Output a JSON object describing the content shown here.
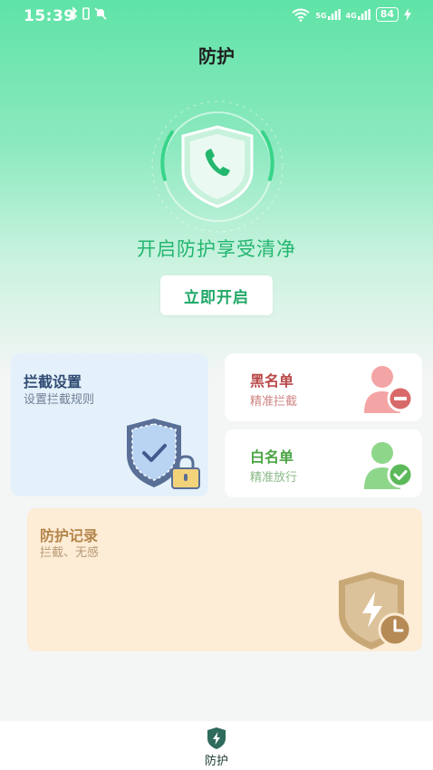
{
  "status_bar": {
    "time": "15:39",
    "battery": "84",
    "network_labels": [
      "5G",
      "4G"
    ]
  },
  "header": {
    "title": "防护"
  },
  "hero": {
    "slogan": "开启防护享受清净",
    "enable_button": "立即开启"
  },
  "cards": {
    "intercept": {
      "title": "拦截设置",
      "subtitle": "设置拦截规则"
    },
    "blacklist": {
      "title": "黑名单",
      "subtitle": "精准拦截"
    },
    "whitelist": {
      "title": "白名单",
      "subtitle": "精准放行"
    },
    "record": {
      "title": "防护记录",
      "subtitle": "拦截、无感"
    }
  },
  "bottom_nav": {
    "items": [
      {
        "label": "防护",
        "icon": "shield-bolt-icon",
        "active": true
      }
    ]
  },
  "colors": {
    "accent": "#23b670",
    "blacklist": "#b94848",
    "whitelist": "#4ba445",
    "record": "#b5854a",
    "intercept": "#2f4a72"
  }
}
